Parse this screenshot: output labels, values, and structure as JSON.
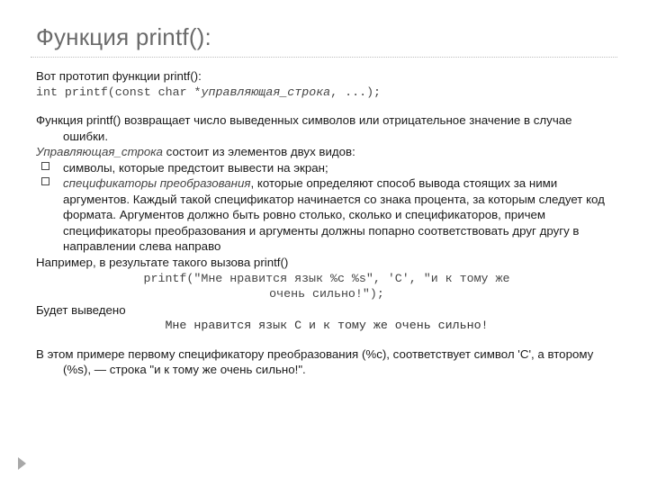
{
  "title": "Функция printf():",
  "intro": "Вот прототип функции printf():",
  "prototype_prefix": "int printf(const char *",
  "prototype_italic": "управляющая_строка",
  "prototype_suffix": ", ...);",
  "ret_desc": "Функция printf() возвращает число выведенных символов или отрицательное значение в случае ошибки.",
  "ustr_sent_italic": "Управляющая_строка",
  "ustr_sent_rest": " состоит из элементов двух видов:",
  "bullets": {
    "b1": "символы, которые предстоит вывести на экран;",
    "b2_italic": "спецификаторы преобразования",
    "b2_rest": ", которые определяют способ вывода стоящих за ними аргументов. Каждый такой спецификатор начинается со знака процента, за которым следует код формата. Аргументов должно быть ровно столько, сколько и спецификаторов, причем спецификаторы преобразования и аргументы должны попарно соответствовать друг другу в направлении слева направо"
  },
  "example_intro": "Например, в результате такого вызова printf()",
  "example_code_line1": "printf(\"Мне нравится язык %c %s\", 'C', \"и к тому же",
  "example_code_line2": "очень сильно!\");",
  "output_label": "Будет выведено",
  "output_text": "Мне нравится язык C и к тому же очень сильно!",
  "final_para": "В этом примере первому спецификатору преобразования (%c), соответствует символ 'C', а второму (%s), — строка \"и к тому же очень сильно!\"."
}
